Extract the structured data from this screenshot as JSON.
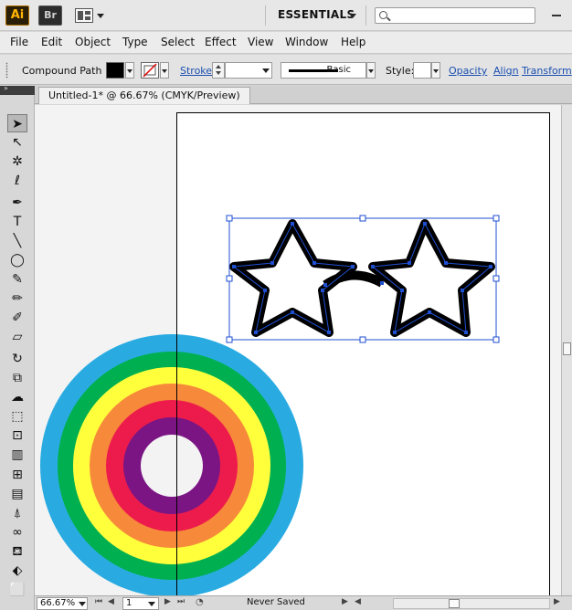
{
  "app": {
    "logo_text": "Ai",
    "bridge_text": "Br",
    "workspace": "ESSENTIALS",
    "search_placeholder": ""
  },
  "menu": {
    "items": [
      {
        "label": "File"
      },
      {
        "label": "Edit"
      },
      {
        "label": "Object"
      },
      {
        "label": "Type"
      },
      {
        "label": "Select"
      },
      {
        "label": "Effect"
      },
      {
        "label": "View"
      },
      {
        "label": "Window"
      },
      {
        "label": "Help"
      }
    ]
  },
  "control": {
    "selection_type": "Compound Path",
    "fill_color": "#000000",
    "stroke_color": "none",
    "stroke_label": "Stroke:",
    "stroke_weight": "",
    "brush_label": "Basic",
    "style_label": "Style:",
    "opacity_link": "Opacity",
    "align_link": "Align",
    "transform_link": "Transform"
  },
  "document": {
    "tab_title": "Untitled-1* @ 66.67% (CMYK/Preview)"
  },
  "toolbox": {
    "tools": [
      {
        "name": "selection-tool",
        "glyph": "➤",
        "active": true
      },
      {
        "name": "direct-selection-tool",
        "glyph": "↖"
      },
      {
        "name": "magic-wand-tool",
        "glyph": "✲"
      },
      {
        "name": "lasso-tool",
        "glyph": "ℓ"
      },
      {
        "name": "pen-tool",
        "glyph": "✒"
      },
      {
        "name": "type-tool",
        "glyph": "T"
      },
      {
        "name": "line-tool",
        "glyph": "╲"
      },
      {
        "name": "ellipse-tool",
        "glyph": "◯"
      },
      {
        "name": "paintbrush-tool",
        "glyph": "✎"
      },
      {
        "name": "pencil-tool",
        "glyph": "✏"
      },
      {
        "name": "blob-brush-tool",
        "glyph": "✐"
      },
      {
        "name": "eraser-tool",
        "glyph": "▱"
      },
      {
        "name": "rotate-tool",
        "glyph": "↻"
      },
      {
        "name": "scale-tool",
        "glyph": "⧉"
      },
      {
        "name": "warp-tool",
        "glyph": "☁"
      },
      {
        "name": "free-transform-tool",
        "glyph": "⬚"
      },
      {
        "name": "symbol-sprayer-tool",
        "glyph": "⊡"
      },
      {
        "name": "column-graph-tool",
        "glyph": "▥"
      },
      {
        "name": "mesh-tool",
        "glyph": "⊞"
      },
      {
        "name": "gradient-tool",
        "glyph": "▤"
      },
      {
        "name": "eyedropper-tool",
        "glyph": "⍋"
      },
      {
        "name": "blend-tool",
        "glyph": "∞"
      },
      {
        "name": "live-paint-bucket-tool",
        "glyph": "⛾"
      },
      {
        "name": "live-paint-selection-tool",
        "glyph": "⬖"
      },
      {
        "name": "artboard-tool",
        "glyph": "⬜"
      }
    ]
  },
  "canvas": {
    "rings": [
      "#29abe2",
      "#00b050",
      "#ffff3c",
      "#f7893a",
      "#ed1b4b",
      "#7b1584",
      "#f3f3f3"
    ],
    "selection_color": "#1f4fd1"
  },
  "status": {
    "zoom": "66.67%",
    "page": "1",
    "save_state": "Never Saved"
  }
}
